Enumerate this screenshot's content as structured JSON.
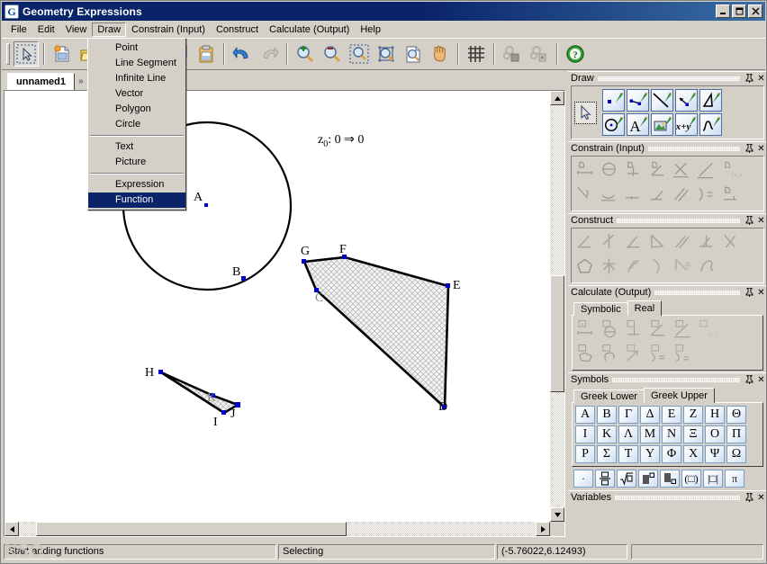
{
  "window": {
    "title": "Geometry Expressions",
    "icon": "app-icon",
    "buttons": {
      "minimize": "_",
      "maximize": "□",
      "close": "✕"
    }
  },
  "menubar": {
    "items": [
      {
        "label": "File",
        "open": false
      },
      {
        "label": "Edit",
        "open": false
      },
      {
        "label": "View",
        "open": false
      },
      {
        "label": "Draw",
        "open": true
      },
      {
        "label": "Constrain (Input)",
        "open": false
      },
      {
        "label": "Construct",
        "open": false
      },
      {
        "label": "Calculate (Output)",
        "open": false
      },
      {
        "label": "Help",
        "open": false
      }
    ]
  },
  "dropdown": {
    "owner": "Draw",
    "groups": [
      {
        "items": [
          {
            "label": "Point",
            "selected": false
          },
          {
            "label": "Line Segment",
            "selected": false
          },
          {
            "label": "Infinite Line",
            "selected": false
          },
          {
            "label": "Vector",
            "selected": false
          },
          {
            "label": "Polygon",
            "selected": false
          },
          {
            "label": "Circle",
            "selected": false
          }
        ]
      },
      {
        "items": [
          {
            "label": "Text",
            "selected": false
          },
          {
            "label": "Picture",
            "selected": false
          }
        ]
      },
      {
        "items": [
          {
            "label": "Expression",
            "selected": false
          },
          {
            "label": "Function",
            "selected": true
          }
        ]
      }
    ]
  },
  "toolbar": {
    "buttons": [
      {
        "name": "select-tool",
        "pressed": true,
        "enabled": true
      },
      {
        "name": "new-document",
        "pressed": false,
        "enabled": true
      },
      {
        "name": "open-document",
        "pressed": false,
        "enabled": true
      },
      {
        "name": "save-document",
        "pressed": false,
        "enabled": true
      },
      {
        "name": "cut",
        "pressed": false,
        "enabled": true
      },
      {
        "name": "copy",
        "pressed": false,
        "enabled": true
      },
      {
        "name": "paste",
        "pressed": false,
        "enabled": true
      },
      {
        "name": "undo",
        "pressed": false,
        "enabled": true
      },
      {
        "name": "redo",
        "pressed": false,
        "enabled": false
      },
      {
        "name": "zoom-in",
        "pressed": false,
        "enabled": true
      },
      {
        "name": "zoom-out",
        "pressed": false,
        "enabled": true
      },
      {
        "name": "zoom-select",
        "pressed": false,
        "enabled": true
      },
      {
        "name": "zoom-fit",
        "pressed": false,
        "enabled": true
      },
      {
        "name": "zoom-page",
        "pressed": false,
        "enabled": true
      },
      {
        "name": "pan",
        "pressed": false,
        "enabled": true
      },
      {
        "name": "grid",
        "pressed": false,
        "enabled": true
      },
      {
        "name": "settings-a",
        "pressed": false,
        "enabled": false
      },
      {
        "name": "settings-b",
        "pressed": false,
        "enabled": false
      },
      {
        "name": "help",
        "pressed": false,
        "enabled": true
      }
    ]
  },
  "document": {
    "tab_label": "unnamed1",
    "tab_overflow": "»"
  },
  "canvas": {
    "annotation": {
      "prefix": "z",
      "subscript": "0",
      "text": ": 0 ⇒ 0"
    },
    "point_labels": [
      "A",
      "B",
      "C",
      "D",
      "E",
      "F",
      "G",
      "H",
      "I",
      "J",
      "K"
    ],
    "shapes": [
      {
        "name": "circle",
        "center_label": "A",
        "on_label": "B"
      },
      {
        "name": "polygon-cdefg",
        "vertex_labels": [
          "G",
          "F",
          "E",
          "D",
          "C"
        ]
      },
      {
        "name": "polygon-hijk",
        "vertex_labels": [
          "H",
          "K",
          "J",
          "I"
        ]
      }
    ]
  },
  "dock": {
    "panels": [
      {
        "title": "Draw",
        "pin": "pin-icon",
        "close": "✕",
        "rows": [
          [
            "draw-point",
            "draw-line-segment",
            "draw-infinite-line",
            "draw-vector",
            "draw-polygon"
          ],
          [
            "draw-circle",
            "draw-text",
            "draw-picture",
            "draw-expression",
            "draw-function"
          ]
        ],
        "select_tool": "select-arrow"
      },
      {
        "title": "Constrain (Input)",
        "pin": "pin-icon",
        "close": "✕",
        "row_counts": [
          7,
          7
        ],
        "enabled": false
      },
      {
        "title": "Construct",
        "pin": "pin-icon",
        "close": "✕",
        "row_counts": [
          7,
          6
        ],
        "enabled": false
      },
      {
        "title": "Calculate (Output)",
        "pin": "pin-icon",
        "close": "✕",
        "tabs": [
          {
            "label": "Symbolic",
            "selected": false
          },
          {
            "label": "Real",
            "selected": true
          }
        ],
        "row_counts": [
          6,
          5
        ],
        "enabled": false
      },
      {
        "title": "Symbols",
        "pin": "pin-icon",
        "close": "✕",
        "tabs": [
          {
            "label": "Greek Lower",
            "selected": false
          },
          {
            "label": "Greek Upper",
            "selected": true
          }
        ],
        "greek_rows": [
          [
            "Α",
            "Β",
            "Γ",
            "Δ",
            "Ε",
            "Ζ",
            "Η",
            "Θ"
          ],
          [
            "Ι",
            "Κ",
            "Λ",
            "Μ",
            "Ν",
            "Ξ",
            "Ο",
            "Π"
          ],
          [
            "Ρ",
            "Σ",
            "Τ",
            "Υ",
            "Φ",
            "Χ",
            "Ψ",
            "Ω"
          ]
        ],
        "operators": [
          "·",
          "fraction",
          "√",
          "superscript",
          "subscript",
          "(□)",
          "|□|",
          "π"
        ]
      },
      {
        "title": "Variables",
        "pin": "pin-icon",
        "close": "✕"
      }
    ]
  },
  "statusbar": {
    "hint": "Start adding functions",
    "mode": "Selecting",
    "coordinates": "(-5.76022,6.12493)",
    "extra": "",
    "watermark": "NSO"
  },
  "colors": {
    "titlebar_start": "#0a246a",
    "titlebar_end": "#3a6ea5",
    "face": "#d4d0c8",
    "point": "#0000cc",
    "selection": "#0a246a",
    "canvas": "#ffffff"
  }
}
